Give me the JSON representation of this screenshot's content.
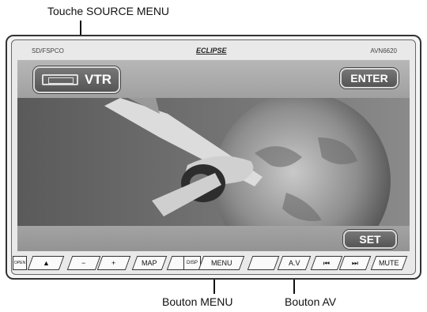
{
  "callouts": {
    "source_menu": "Touche SOURCE MENU",
    "menu": "Bouton MENU",
    "av": "Bouton AV"
  },
  "unit": {
    "small_logo": "SD/FSPCO",
    "brand": "ECLIPSE",
    "model": "AVN6620"
  },
  "screen": {
    "source_label": "VTR",
    "enter_label": "ENTER",
    "set_label": "SET"
  },
  "buttons": {
    "eject": "▲",
    "minus": "−",
    "plus": "+",
    "map": "MAP",
    "disp": "DISP",
    "menu": "MENU",
    "av": "A.V",
    "prev": "⏮",
    "next": "⏭",
    "mute": "MUTE",
    "left_small": "OPEN"
  },
  "icons": {
    "cassette": "cassette-icon",
    "eject": "eject-icon",
    "prev": "prev-track-icon",
    "next": "next-track-icon"
  },
  "colors": {
    "screen_bg": "#9c9c9c",
    "button_bg": "#5f5f5f",
    "button_border": "#d8d8d8"
  }
}
